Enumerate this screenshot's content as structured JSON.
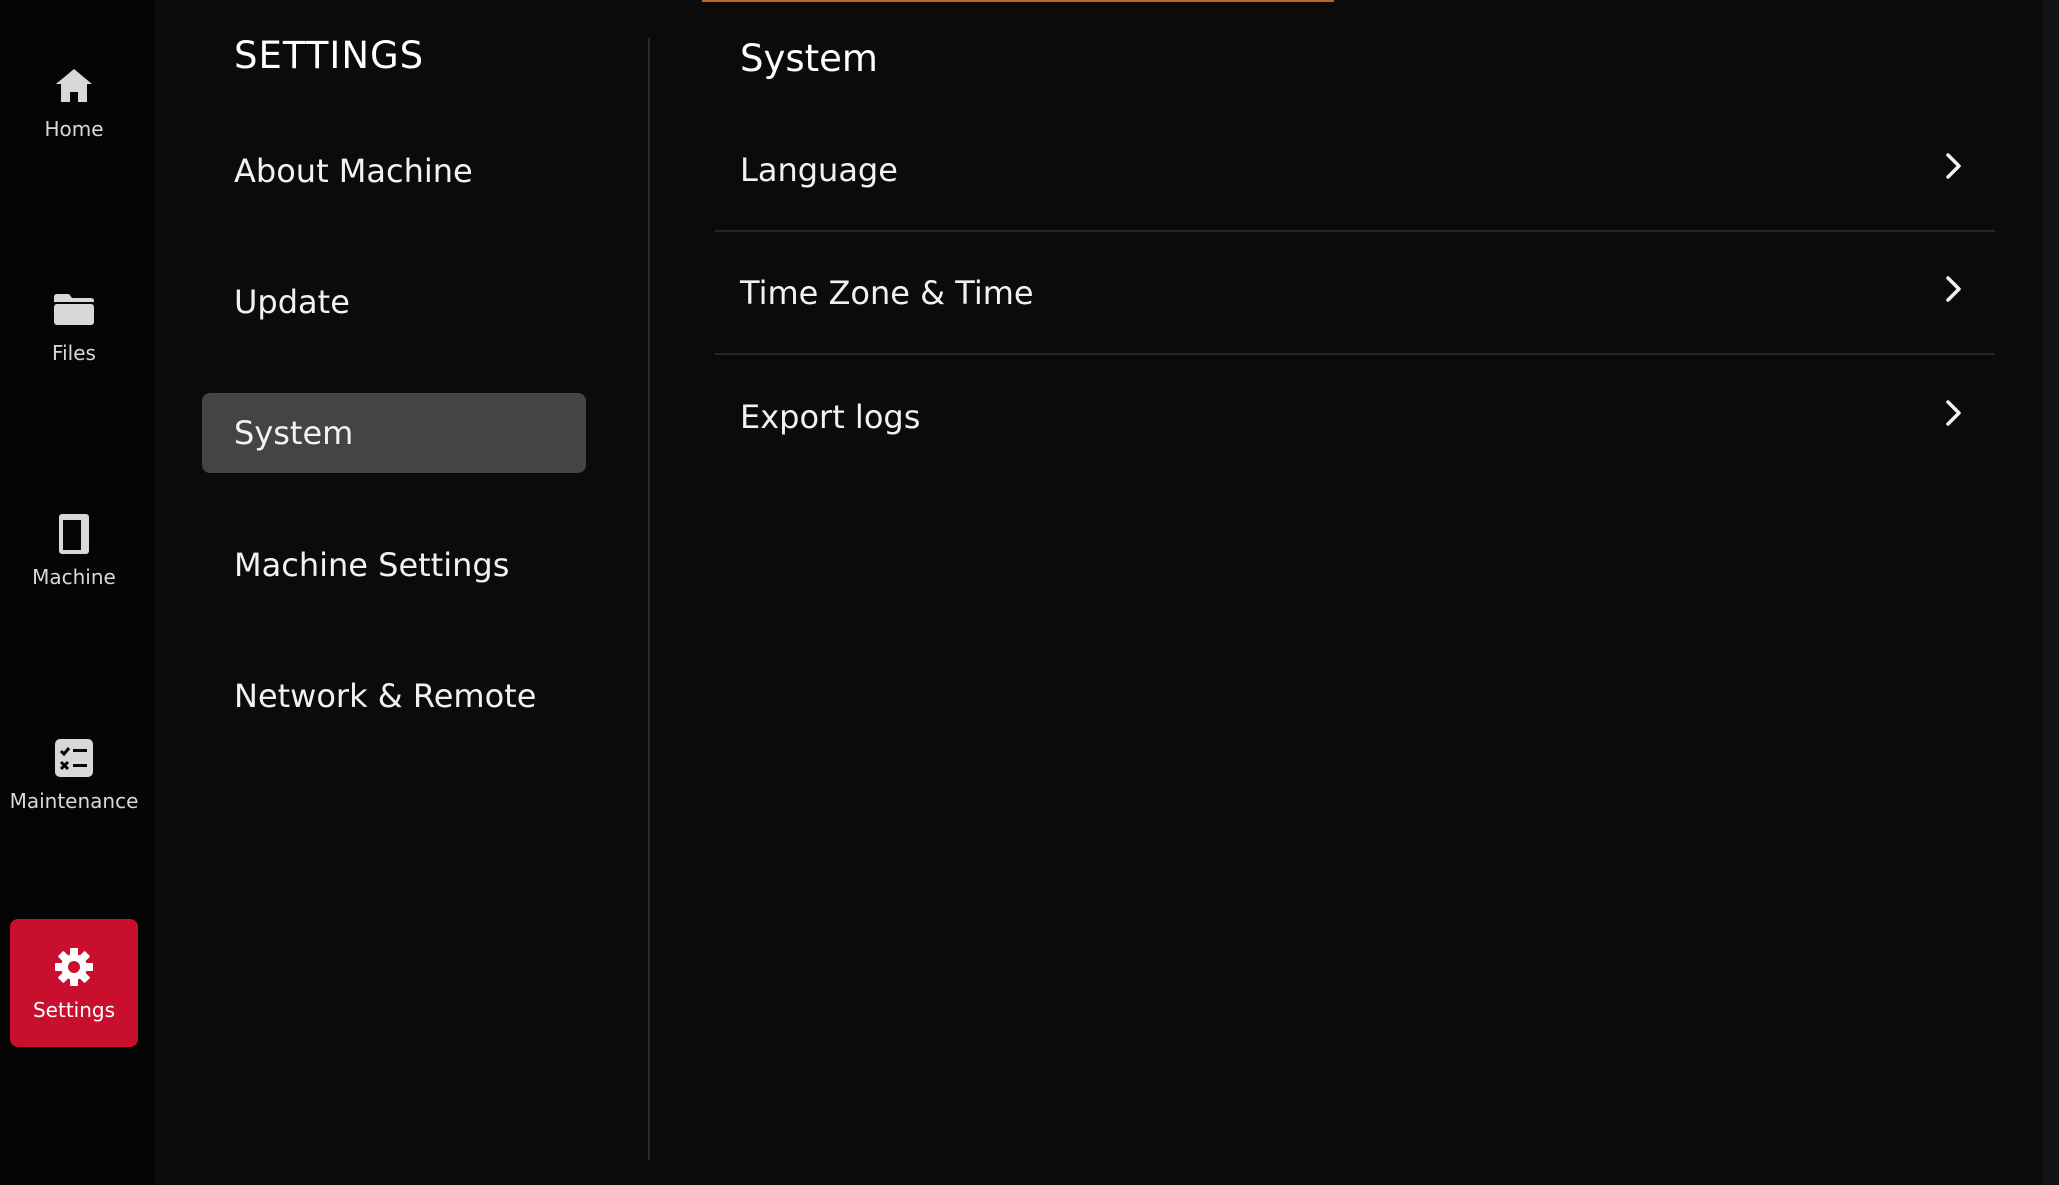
{
  "nav": {
    "items": [
      {
        "label": "Home",
        "icon": "home-icon"
      },
      {
        "label": "Files",
        "icon": "folder-icon"
      },
      {
        "label": "Machine",
        "icon": "machine-icon"
      },
      {
        "label": "Maintenance",
        "icon": "maintenance-checklist-icon"
      },
      {
        "label": "Settings",
        "icon": "gear-icon",
        "active": true
      }
    ]
  },
  "settings": {
    "title": "SETTINGS",
    "menu": [
      {
        "label": "About Machine"
      },
      {
        "label": "Update"
      },
      {
        "label": "System",
        "selected": true
      },
      {
        "label": "Machine Settings"
      },
      {
        "label": "Network & Remote"
      }
    ]
  },
  "panel": {
    "title": "System",
    "rows": [
      {
        "label": "Language"
      },
      {
        "label": "Time Zone & Time"
      },
      {
        "label": "Export logs"
      }
    ]
  },
  "colors": {
    "background": "#0b0b0b",
    "nav_background": "#050505",
    "accent_active": "#c8102e",
    "selected_item": "#444444",
    "top_accent": "#c6661d"
  }
}
